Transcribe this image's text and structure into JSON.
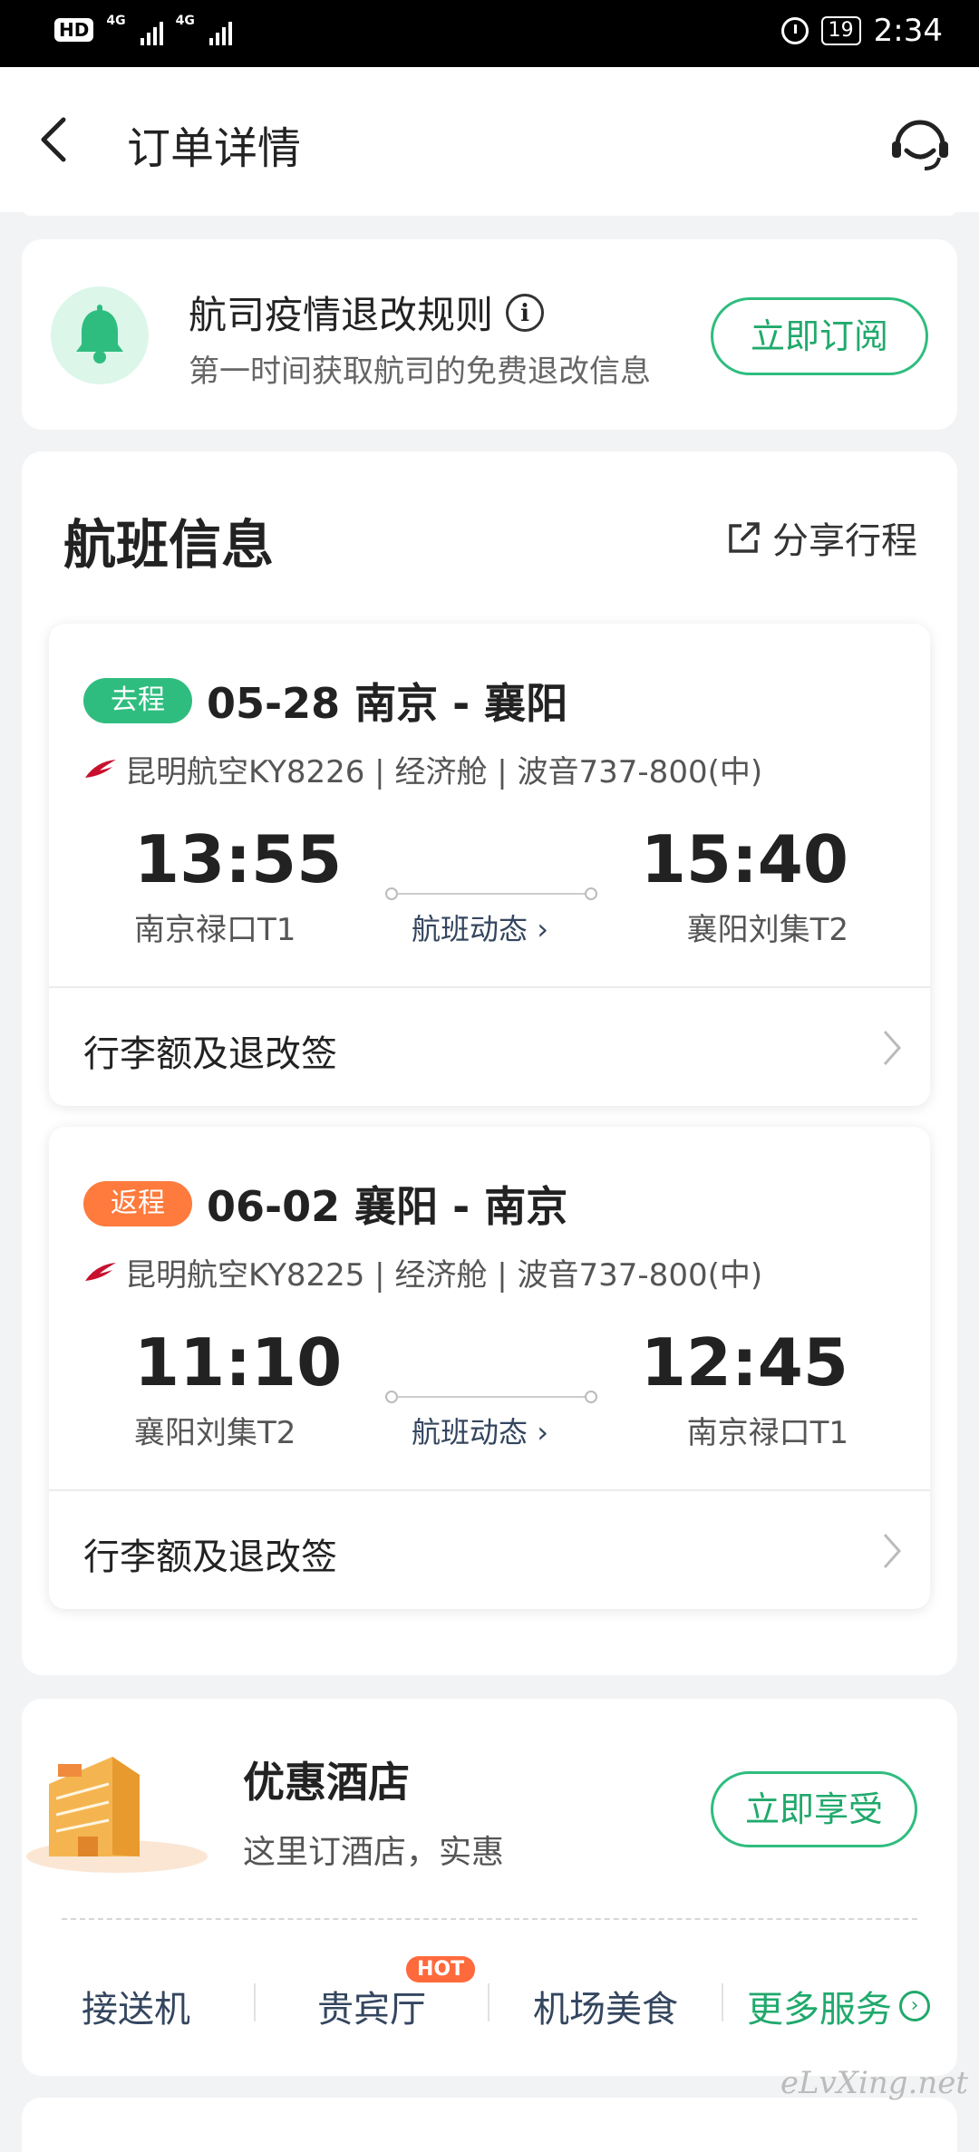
{
  "status_bar": {
    "network_1": "4G",
    "network_2": "4G",
    "battery": "19",
    "time": "2:34"
  },
  "header": {
    "title": "订单详情"
  },
  "notice": {
    "title": "航司疫情退改规则",
    "subtitle": "第一时间获取航司的免费退改信息",
    "button": "立即订阅"
  },
  "flight_section": {
    "title": "航班信息",
    "share_label": "分享行程",
    "legs": [
      {
        "tag": "去程",
        "route": "05-28 南京 - 襄阳",
        "airline_info": "昆明航空KY8226 | 经济舱 | 波音737-800(中)",
        "depart_time": "13:55",
        "arrive_time": "15:40",
        "depart_airport": "南京禄口T1",
        "arrive_airport": "襄阳刘集T2",
        "status_link": "航班动态",
        "baggage": "行李额及退改签"
      },
      {
        "tag": "返程",
        "route": "06-02 襄阳 - 南京",
        "airline_info": "昆明航空KY8225 | 经济舱 | 波音737-800(中)",
        "depart_time": "11:10",
        "arrive_time": "12:45",
        "depart_airport": "襄阳刘集T2",
        "arrive_airport": "南京禄口T1",
        "status_link": "航班动态",
        "baggage": "行李额及退改签"
      }
    ]
  },
  "hotel": {
    "title": "优惠酒店",
    "subtitle": "这里订酒店，实惠",
    "button": "立即享受"
  },
  "services": {
    "items": [
      "接送机",
      "贵宾厅",
      "机场美食",
      "更多服务"
    ],
    "hot_badge": "HOT"
  },
  "watermark": "eLvXing.net",
  "colors": {
    "accent": "#2fbd7f",
    "return_tag": "#ff7a3d",
    "hot": "#ff6a3d"
  }
}
